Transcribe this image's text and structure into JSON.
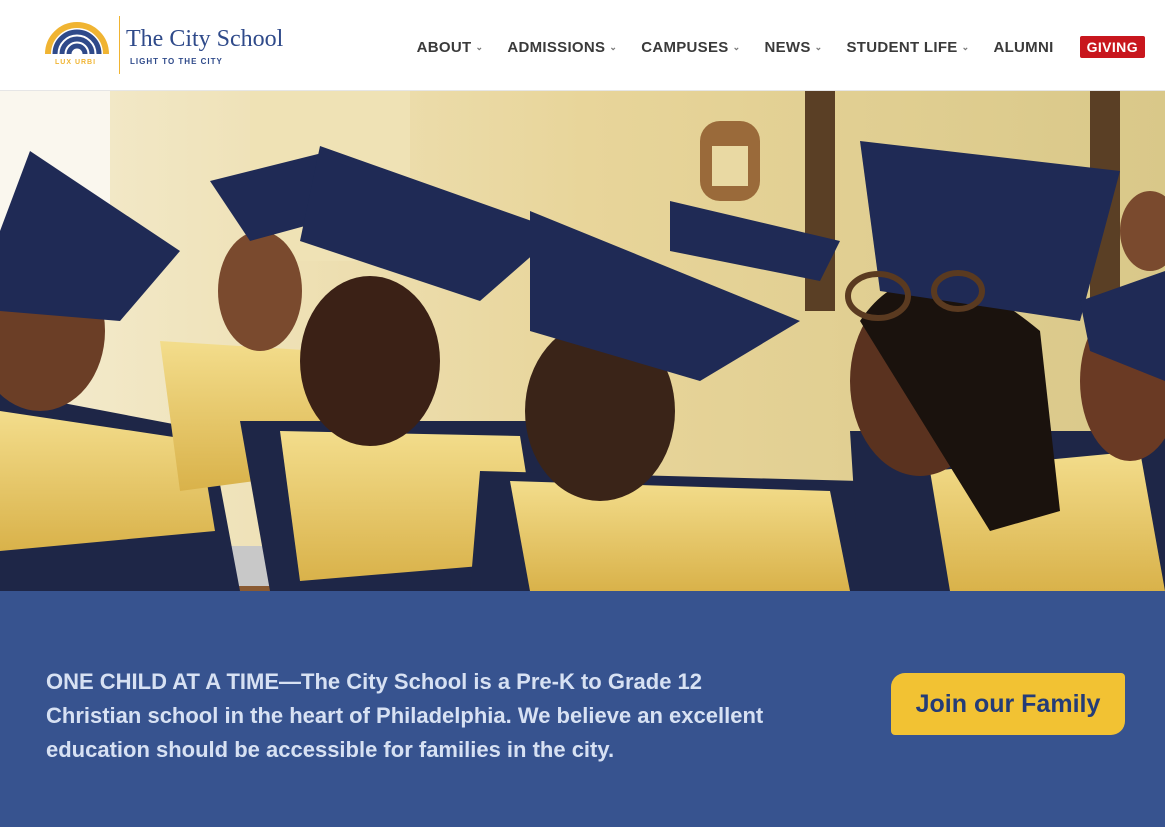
{
  "logo": {
    "name": "The City School",
    "tagline": "LIGHT TO THE CITY",
    "motto": "LUX URBI"
  },
  "nav": {
    "items": [
      {
        "label": "ABOUT",
        "has_dropdown": true
      },
      {
        "label": "ADMISSIONS",
        "has_dropdown": true
      },
      {
        "label": "CAMPUSES",
        "has_dropdown": true
      },
      {
        "label": "NEWS",
        "has_dropdown": true
      },
      {
        "label": "STUDENT LIFE",
        "has_dropdown": true
      },
      {
        "label": "ALUMNI",
        "has_dropdown": false
      }
    ],
    "giving_label": "GIVING"
  },
  "hero": {
    "icon": "graduation-photo"
  },
  "mission": {
    "text": "ONE CHILD AT A TIME—The City School is a Pre-K to Grade 12 Christian school in the heart of Philadelphia. We believe an excellent education should be accessible for families in the city."
  },
  "cta": {
    "label": "Join our Family"
  },
  "colors": {
    "brand_blue": "#37538f",
    "accent_gold": "#f2c233",
    "giving_red": "#c8161d"
  }
}
